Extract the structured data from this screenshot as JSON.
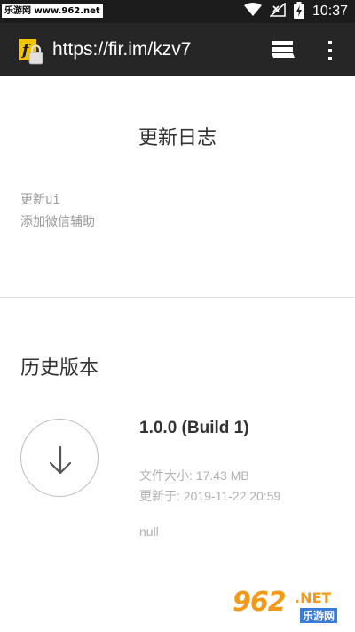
{
  "status_bar": {
    "watermark": "乐游网 www.962.net",
    "time": "10:37"
  },
  "app_bar": {
    "url": "https://fir.im/kzv7",
    "site_icon_letter": "f",
    "icons": [
      "site-lock-icon",
      "tabs-icon",
      "overflow-menu-icon"
    ]
  },
  "changelog": {
    "title": "更新日志",
    "lines": [
      "更新ui",
      "添加微信辅助"
    ]
  },
  "history": {
    "title": "历史版本",
    "versions": [
      {
        "name": "1.0.0 (Build 1)",
        "size_label": "文件大小: ",
        "size": "17.43 MB",
        "updated_label": "更新于: ",
        "updated": "2019-11-22 20:59",
        "notes": "null"
      }
    ]
  },
  "watermark_logo": {
    "number": "962",
    "suffix": ".NET",
    "name": "乐游网"
  },
  "colors": {
    "status_bar": "#1c1c1c",
    "app_bar": "#262626",
    "title_text": "#333333",
    "muted_text": "#9a9a9a",
    "watermark_orange": "#f39a1b"
  }
}
